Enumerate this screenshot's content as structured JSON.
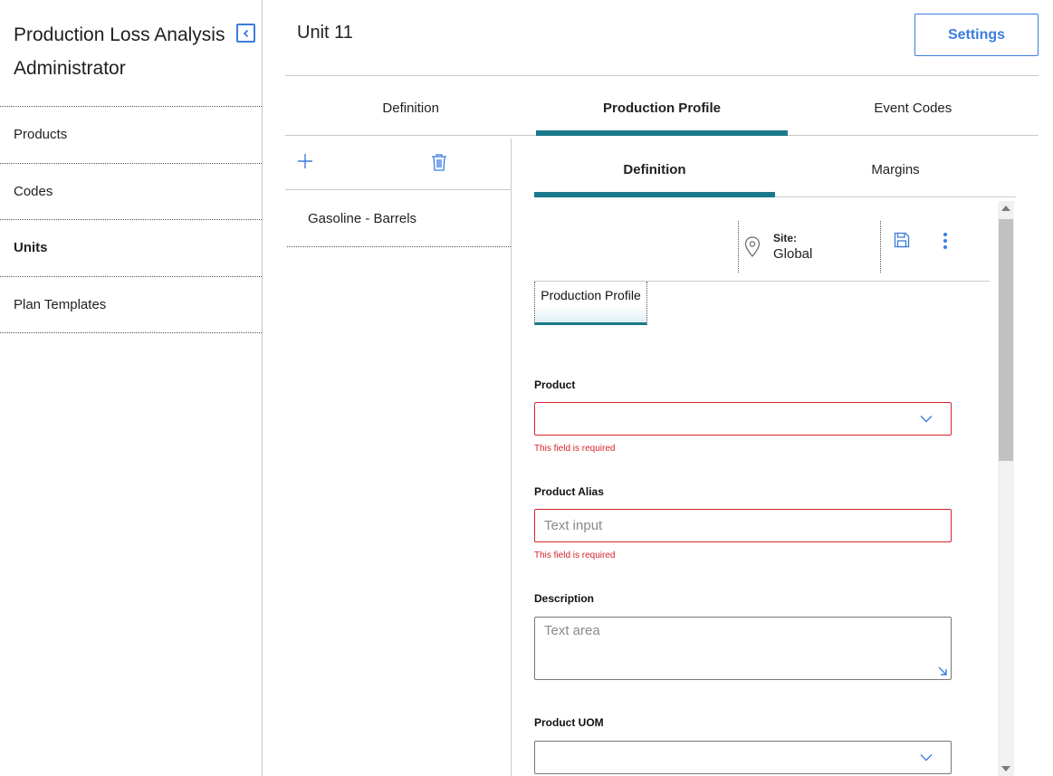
{
  "sidebar": {
    "title": "Production Loss Analysis Administrator",
    "collapse_icon": "collapse-left-icon",
    "items": [
      {
        "label": "Products",
        "active": false
      },
      {
        "label": "Codes",
        "active": false
      },
      {
        "label": "Units",
        "active": true
      },
      {
        "label": "Plan Templates",
        "active": false
      }
    ]
  },
  "header": {
    "title": "Unit 11",
    "settings_label": "Settings"
  },
  "main_tabs": [
    {
      "label": "Definition",
      "active": false
    },
    {
      "label": "Production Profile",
      "active": true
    },
    {
      "label": "Event Codes",
      "active": false
    }
  ],
  "list_panel": {
    "add_icon": "plus-icon",
    "delete_icon": "trash-icon",
    "items": [
      {
        "label": "Gasoline - Barrels"
      }
    ]
  },
  "detail": {
    "sub_tabs": [
      {
        "label": "Definition",
        "active": true
      },
      {
        "label": "Margins",
        "active": false
      }
    ],
    "site_label": "Site:",
    "site_value": "Global",
    "section_chip": "Production Profile",
    "fields": {
      "product": {
        "label": "Product",
        "value": "",
        "error": "This field is required"
      },
      "product_alias": {
        "label": "Product Alias",
        "placeholder": "Text input",
        "error": "This field is required"
      },
      "description": {
        "label": "Description",
        "placeholder": "Text area"
      },
      "product_uom": {
        "label": "Product UOM",
        "value": ""
      }
    }
  },
  "colors": {
    "accent": "#1a7a8c",
    "link": "#3b7ddd",
    "error": "#d9232e"
  }
}
